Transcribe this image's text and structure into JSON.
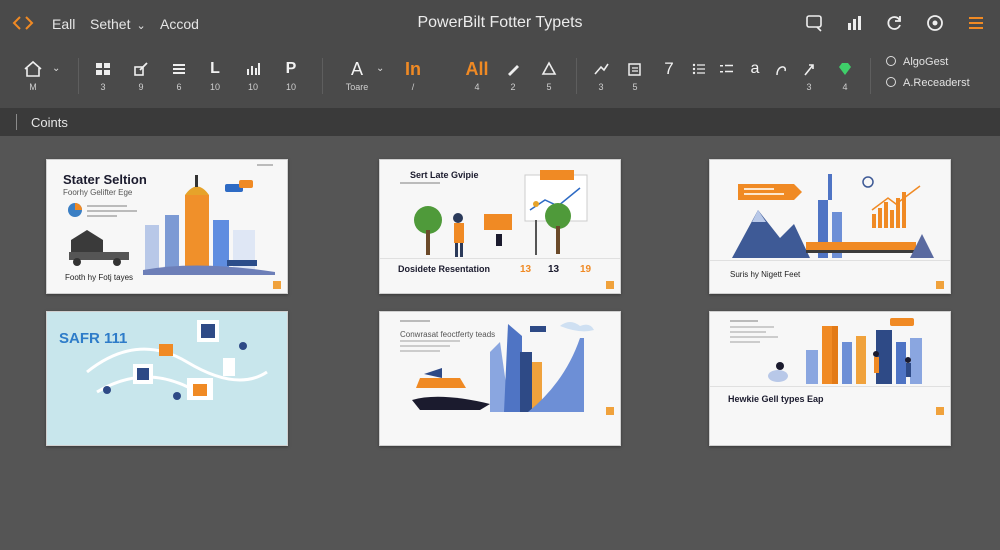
{
  "app": {
    "title": "PowerBilt Fotter Typets"
  },
  "menu": {
    "items": [
      {
        "label": "Eall"
      },
      {
        "label": "Sethet"
      },
      {
        "label": "Accod"
      }
    ]
  },
  "toolbar": {
    "tools": [
      {
        "icon": "home-icon",
        "label": "M"
      },
      {
        "icon": "grid-icon",
        "label": "3"
      },
      {
        "icon": "edit-icon",
        "label": "9"
      },
      {
        "icon": "list-icon",
        "label": "6"
      },
      {
        "icon": "L",
        "label": "10"
      },
      {
        "icon": "chart-icon",
        "label": "10"
      },
      {
        "icon": "P",
        "label": "10"
      },
      {
        "icon": "A",
        "label": "Toare"
      },
      {
        "icon": "In",
        "label": "/"
      },
      {
        "icon": "All",
        "label": "4"
      },
      {
        "icon": "pen-icon",
        "label": "2"
      },
      {
        "icon": "shape-icon",
        "label": "5"
      },
      {
        "icon": "arrow-icon",
        "label": "3"
      },
      {
        "icon": "note-icon",
        "label": "5"
      },
      {
        "icon": "7",
        "label": ""
      },
      {
        "icon": "bullet-list-icon",
        "label": ""
      },
      {
        "icon": "number-list-icon",
        "label": ""
      },
      {
        "icon": "a",
        "label": ""
      },
      {
        "icon": "curve-icon",
        "label": ""
      },
      {
        "icon": "cursor-icon",
        "label": "3"
      },
      {
        "icon": "gem-icon",
        "label": "4"
      }
    ],
    "options": [
      {
        "label": "AlgoGest"
      },
      {
        "label": "A.Receaderst"
      }
    ]
  },
  "section": {
    "label": "Coints"
  },
  "slides": [
    {
      "title": "Stater Seltion",
      "subtitle": "Foorhy Gelifter Ege",
      "footer": "Footh hy Fotj tayes"
    },
    {
      "title": "Sert Late Gvipie",
      "subtitle": "Dosidete Resentation",
      "stats": [
        "13",
        "13",
        "19"
      ]
    },
    {
      "title": "",
      "footer": "Suris hy Nigett Feet"
    },
    {
      "title": "SAFR 111"
    },
    {
      "title": "",
      "subtitle": "Conwrasat feoctferty teads"
    },
    {
      "title": "",
      "footer": "Hewkie Gell types Eap"
    }
  ],
  "colors": {
    "accent": "#f08a24",
    "background": "#555555",
    "toolbar": "#4a4a4a"
  }
}
